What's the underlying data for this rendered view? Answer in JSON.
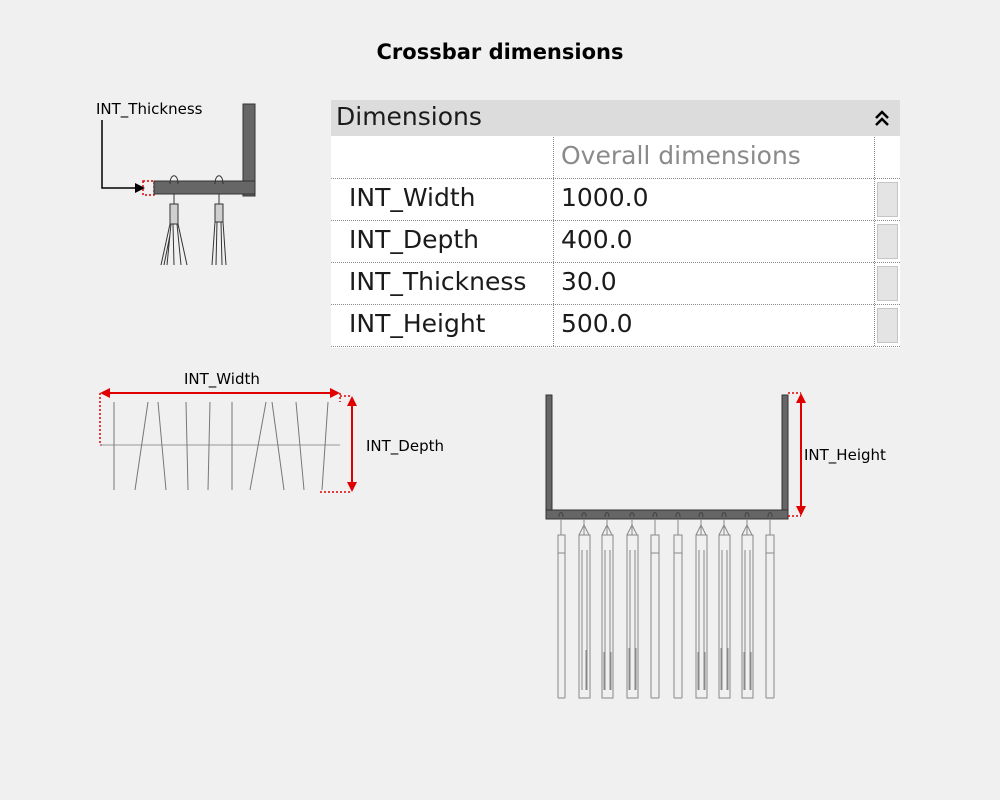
{
  "title": "Crossbar dimensions",
  "callouts": {
    "thickness": "INT_Thickness",
    "width": "INT_Width",
    "depth": "INT_Depth",
    "height": "INT_Height"
  },
  "properties_panel": {
    "header": "Dimensions",
    "collapse_icon": "double-chevron-up-icon",
    "group_label": "Overall dimensions",
    "rows": [
      {
        "name": "INT_Width",
        "value": "1000.0"
      },
      {
        "name": "INT_Depth",
        "value": "400.0"
      },
      {
        "name": "INT_Thickness",
        "value": "30.0"
      },
      {
        "name": "INT_Height",
        "value": "500.0"
      }
    ]
  },
  "colors": {
    "background": "#f0f0f0",
    "dimension_accent": "#e00000",
    "crossbar_fill": "#666666",
    "panel_header": "#dcdcdc"
  }
}
